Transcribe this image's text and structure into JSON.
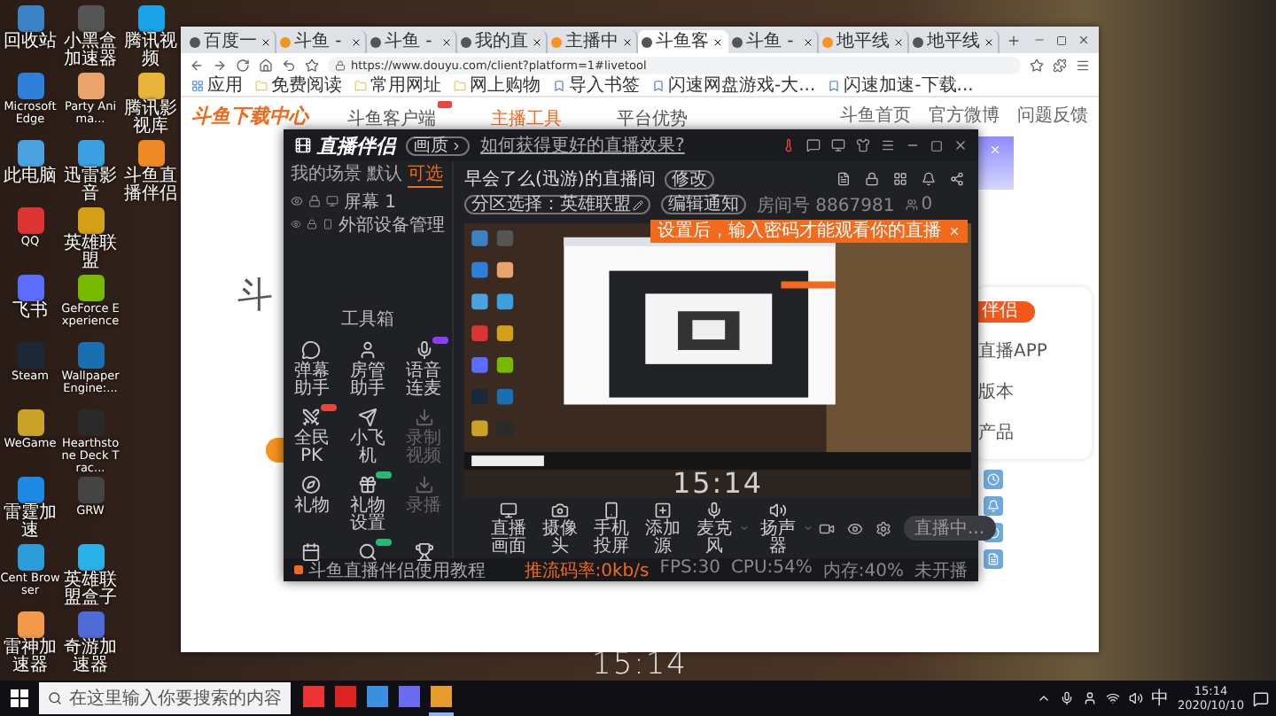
{
  "desktop": {
    "icon_columns": [
      [
        {
          "label": "回收站"
        },
        {
          "label": "Microsoft Edge"
        },
        {
          "label": "此电脑"
        },
        {
          "label": "QQ"
        },
        {
          "label": "飞书"
        },
        {
          "label": "Steam"
        },
        {
          "label": "WeGame"
        },
        {
          "label": "雷霆加速"
        },
        {
          "label": "Cent Browser"
        },
        {
          "label": "雷神加速器"
        }
      ],
      [
        {
          "label": "小黑盒加速器"
        },
        {
          "label": "Party Anima..."
        },
        {
          "label": "迅雷影音"
        },
        {
          "label": "英雄联盟"
        },
        {
          "label": "GeForce Experience"
        },
        {
          "label": "Wallpaper Engine:..."
        },
        {
          "label": "Hearthstone Deck Trac..."
        },
        {
          "label": "GRW"
        },
        {
          "label": "英雄联盟盒子"
        },
        {
          "label": "奇游加速器"
        }
      ],
      [
        {
          "label": "腾讯视频"
        },
        {
          "label": "腾讯影视库"
        },
        {
          "label": "斗鱼直播伴侣"
        }
      ]
    ],
    "clock": "15:14"
  },
  "browser": {
    "tabs": [
      {
        "label": "百度一",
        "selected": false
      },
      {
        "label": "斗鱼 -",
        "selected": false
      },
      {
        "label": "斗鱼 -",
        "selected": false
      },
      {
        "label": "我的直",
        "selected": false
      },
      {
        "label": "主播中",
        "selected": false
      },
      {
        "label": "斗鱼客",
        "selected": true
      },
      {
        "label": "斗鱼 -",
        "selected": false
      },
      {
        "label": "地平线",
        "selected": false
      },
      {
        "label": "地平线",
        "selected": false
      }
    ],
    "url": "https://www.douyu.com/client?platform=1#livetool",
    "bookmarks": [
      "应用",
      "免费阅读",
      "常用网址",
      "网上购物",
      "导入书签",
      "闪速网盘游戏-大...",
      "闪速加速-下载..."
    ],
    "site": {
      "logo": "斗鱼下载中心",
      "nav": [
        {
          "label": "斗鱼客户端",
          "selected": false,
          "badge": true
        },
        {
          "label": "主播工具",
          "selected": true,
          "badge": false
        },
        {
          "label": "平台优势",
          "selected": false,
          "badge": false
        }
      ],
      "links": [
        "斗鱼首页",
        "官方微博",
        "问题反馈"
      ],
      "hero_char": "斗",
      "side_button": "伴侣",
      "side_items": [
        "直播APP",
        "版本",
        "产品"
      ]
    }
  },
  "live_app": {
    "title": "直播伴侣",
    "quality": "画质",
    "help_link": "如何获得更好的直播效果?",
    "scene_tabs": [
      {
        "label": "我的场景",
        "selected": false
      },
      {
        "label": "默认",
        "selected": false
      },
      {
        "label": "可选",
        "selected": true
      }
    ],
    "sources": [
      {
        "label": "屏幕 1",
        "kind": "screen"
      },
      {
        "label": "外部设备管理",
        "kind": "device"
      }
    ],
    "toolbox_title": "工具箱",
    "tools": [
      {
        "label": "弹幕助手",
        "disabled": false
      },
      {
        "label": "房管助手",
        "disabled": false
      },
      {
        "label": "语音连麦",
        "disabled": false,
        "color": "#8a3ffc"
      },
      {
        "label": "全民PK",
        "disabled": false,
        "color": "#e8453c"
      },
      {
        "label": "小飞机",
        "disabled": false
      },
      {
        "label": "录制视频",
        "disabled": true
      },
      {
        "label": "礼物",
        "disabled": false
      },
      {
        "label": "礼物设置",
        "disabled": false,
        "color": "#2bb673"
      },
      {
        "label": "录播",
        "disabled": true
      },
      {
        "disabled": false
      },
      {
        "disabled": false,
        "color": "#2bb673"
      },
      {
        "disabled": false
      }
    ],
    "room_title": "早会了么(迅游)的直播间",
    "edit": "修改",
    "category": "分区选择：英雄联盟",
    "notice": "编辑通知",
    "room_id": "房间号 8867981",
    "viewers": "0",
    "tooltip": "设置后，输入密码才能观看你的直播",
    "preview_clock": "15:14",
    "controls": [
      {
        "label": "直播画面",
        "kind": "screen",
        "dropdown": false
      },
      {
        "label": "摄像头",
        "kind": "camera",
        "dropdown": false
      },
      {
        "label": "手机投屏",
        "kind": "phone",
        "dropdown": false
      },
      {
        "label": "添加源",
        "kind": "add",
        "dropdown": false
      },
      {
        "label": "麦克风",
        "kind": "mic",
        "dropdown": true
      },
      {
        "label": "扬声器",
        "kind": "speaker",
        "dropdown": true
      }
    ],
    "live_button": "直播中...",
    "tutorial": "斗鱼直播伴侣使用教程",
    "stats": [
      {
        "label": "推流码率:0kb/s",
        "highlight": true
      },
      {
        "label": "FPS:30",
        "highlight": false
      },
      {
        "label": "CPU:54%",
        "highlight": false
      },
      {
        "label": "内存:40%",
        "highlight": false
      },
      {
        "label": "未开播",
        "highlight": false
      }
    ]
  },
  "taskbar": {
    "search_placeholder": "在这里输入你要搜索的内容",
    "ime": "中",
    "time": "15:14",
    "date": "2020/10/10"
  }
}
